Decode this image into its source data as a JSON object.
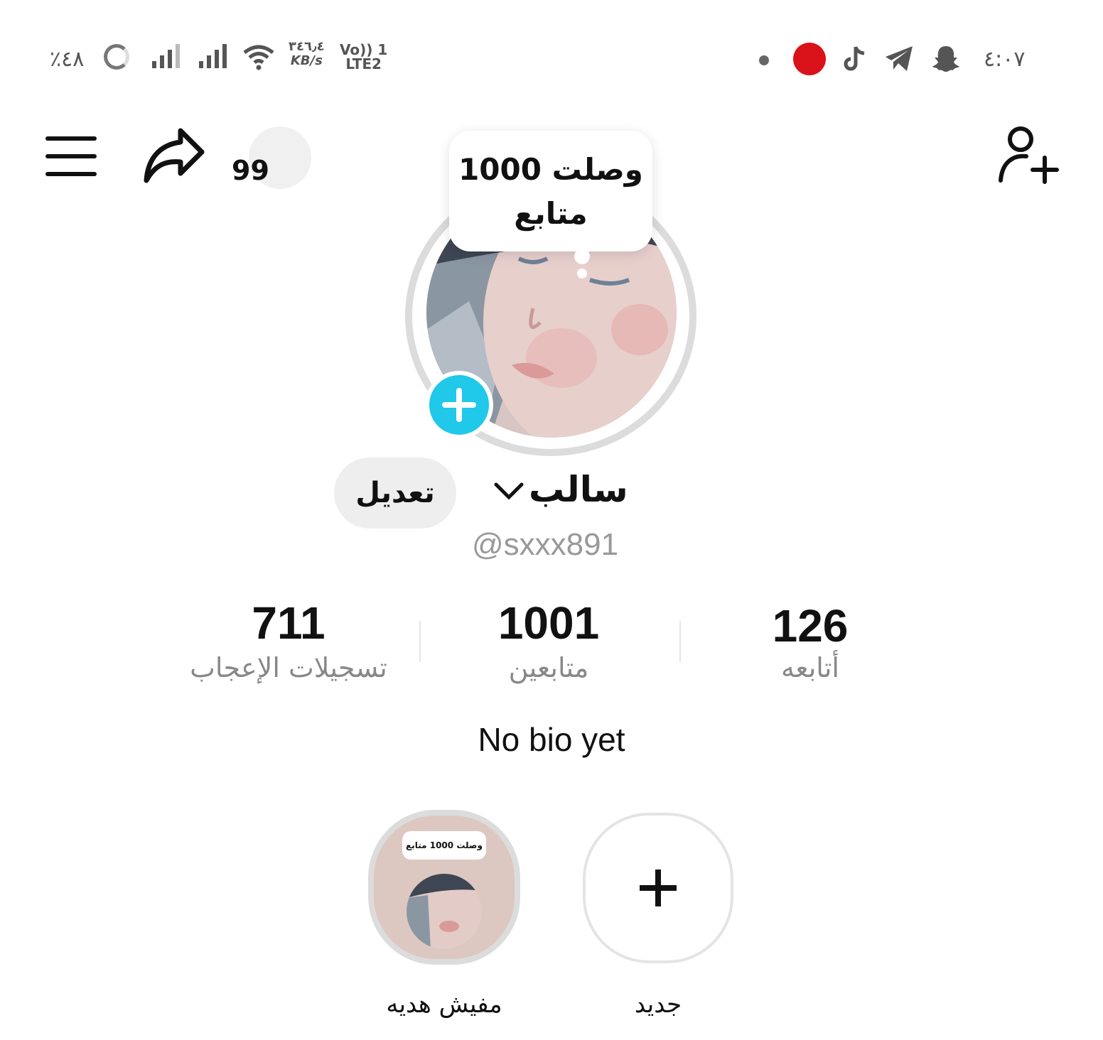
{
  "status_bar": {
    "battery": "٪٤٨",
    "speed_value": "٣٤٦٫٤",
    "speed_unit": "KB/s",
    "network_line1": "Vo)) 1",
    "network_line2": "LTE2",
    "time": "٤:٠٧",
    "icons": [
      "battery-ring-icon",
      "signal-icon",
      "signal-icon",
      "wifi-icon",
      "recorder-icon",
      "tiktok-icon",
      "telegram-icon",
      "snapchat-icon"
    ]
  },
  "top_bar": {
    "share_count": "99",
    "icons": [
      "menu-icon",
      "share-icon",
      "add-friend-icon"
    ]
  },
  "note": {
    "line1": "وصلت 1000",
    "line2": "متابع"
  },
  "profile": {
    "display_name": "سالب",
    "edit_label": "تعديل",
    "username": "@sxxx891",
    "bio": "No bio yet",
    "accent": "#20c8ea"
  },
  "stats": [
    {
      "value": "711",
      "label": "تسجيلات الإعجاب"
    },
    {
      "value": "1001",
      "label": "متابعين"
    },
    {
      "value": "126",
      "label": "أتابعه"
    }
  ],
  "highlights": [
    {
      "label": "مفيش هديه",
      "note": "وصلت 1000 متابع"
    },
    {
      "label": "جديد"
    }
  ]
}
